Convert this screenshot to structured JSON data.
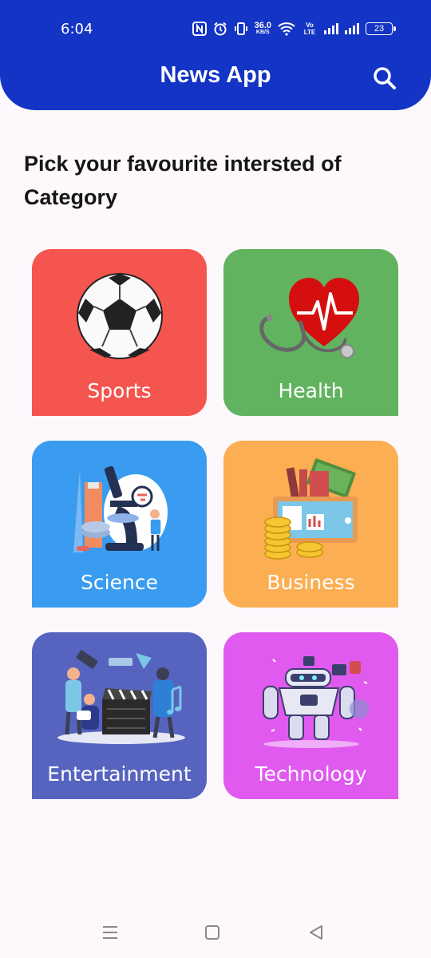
{
  "status_bar": {
    "time": "6:04",
    "speed_value": "36.0",
    "speed_unit": "KB/S",
    "volte": "Vo LTE",
    "battery": "23"
  },
  "app_bar": {
    "title": "News App",
    "search_icon": "search-icon",
    "background": "#1334c4"
  },
  "heading": "Pick your favourite intersted of Category",
  "categories": [
    {
      "label": "Sports",
      "color": "#f4554f",
      "icon": "soccer-ball"
    },
    {
      "label": "Health",
      "color": "#62b35f",
      "icon": "heart-stethoscope"
    },
    {
      "label": "Science",
      "color": "#3a9cf0",
      "icon": "microscope-lab"
    },
    {
      "label": "Business",
      "color": "#fcae52",
      "icon": "coins-tablet"
    },
    {
      "label": "Entertainment",
      "color": "#5664bf",
      "icon": "clapperboard-music"
    },
    {
      "label": "Technology",
      "color": "#e05af0",
      "icon": "robot"
    }
  ],
  "nav_bar": {
    "buttons": [
      "menu-icon",
      "home-square-icon",
      "back-triangle-icon"
    ]
  }
}
